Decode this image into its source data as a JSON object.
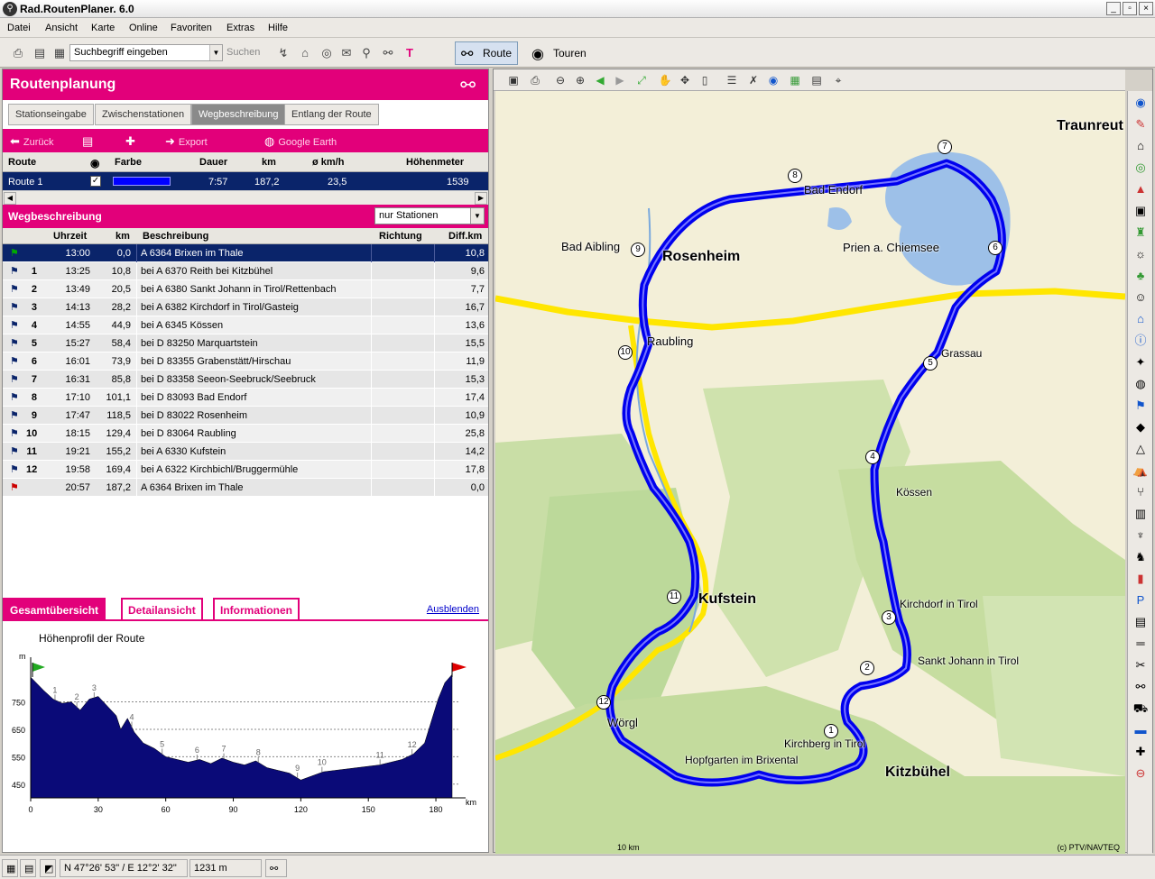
{
  "window": {
    "title": "Rad.RoutenPlaner. 6.0"
  },
  "menu": [
    "Datei",
    "Ansicht",
    "Karte",
    "Online",
    "Favoriten",
    "Extras",
    "Hilfe"
  ],
  "toolbar": {
    "search_value": "Suchbegriff eingeben",
    "search_button": "Suchen",
    "route_button": "Route",
    "tours_button": "Touren"
  },
  "panel": {
    "title": "Routenplanung",
    "tabs": [
      "Stationseingabe",
      "Zwischenstationen",
      "Wegbeschreibung",
      "Entlang der Route"
    ],
    "actions": {
      "back": "Zurück",
      "export": "Export",
      "google_earth": "Google Earth"
    },
    "route_table": {
      "headers": [
        "Route",
        "Farbe",
        "Dauer",
        "km",
        "ø km/h",
        "Höhenmeter"
      ],
      "row": {
        "name": "Route 1",
        "duration": "7:57",
        "km": "187,2",
        "speed": "23,5",
        "elevation": "1539",
        "color": "#0000ff"
      }
    },
    "wegbeschreibung": {
      "title": "Wegbeschreibung",
      "filter": "nur Stationen",
      "headers": [
        "Uhrzeit",
        "km",
        "Beschreibung",
        "Richtung",
        "Diff.km"
      ],
      "rows": [
        {
          "num": "",
          "time": "13:00",
          "km": "0,0",
          "desc": "A 6364 Brixen im Thale",
          "dir": "",
          "diff": "10,8"
        },
        {
          "num": "1",
          "time": "13:25",
          "km": "10,8",
          "desc": "bei A 6370 Reith bei Kitzbühel",
          "dir": "",
          "diff": "9,6"
        },
        {
          "num": "2",
          "time": "13:49",
          "km": "20,5",
          "desc": "bei A 6380 Sankt Johann in Tirol/Rettenbach",
          "dir": "",
          "diff": "7,7"
        },
        {
          "num": "3",
          "time": "14:13",
          "km": "28,2",
          "desc": "bei A 6382 Kirchdorf in Tirol/Gasteig",
          "dir": "",
          "diff": "16,7"
        },
        {
          "num": "4",
          "time": "14:55",
          "km": "44,9",
          "desc": "bei A 6345 Kössen",
          "dir": "",
          "diff": "13,6"
        },
        {
          "num": "5",
          "time": "15:27",
          "km": "58,4",
          "desc": "bei D 83250 Marquartstein",
          "dir": "",
          "diff": "15,5"
        },
        {
          "num": "6",
          "time": "16:01",
          "km": "73,9",
          "desc": "bei D 83355 Grabenstätt/Hirschau",
          "dir": "",
          "diff": "11,9"
        },
        {
          "num": "7",
          "time": "16:31",
          "km": "85,8",
          "desc": "bei D 83358 Seeon-Seebruck/Seebruck",
          "dir": "",
          "diff": "15,3"
        },
        {
          "num": "8",
          "time": "17:10",
          "km": "101,1",
          "desc": "bei D 83093 Bad Endorf",
          "dir": "",
          "diff": "17,4"
        },
        {
          "num": "9",
          "time": "17:47",
          "km": "118,5",
          "desc": "bei D 83022 Rosenheim",
          "dir": "",
          "diff": "10,9"
        },
        {
          "num": "10",
          "time": "18:15",
          "km": "129,4",
          "desc": "bei D 83064 Raubling",
          "dir": "",
          "diff": "25,8"
        },
        {
          "num": "11",
          "time": "19:21",
          "km": "155,2",
          "desc": "bei A 6330 Kufstein",
          "dir": "",
          "diff": "14,2"
        },
        {
          "num": "12",
          "time": "19:58",
          "km": "169,4",
          "desc": "bei A 6322 Kirchbichl/Bruggermühle",
          "dir": "",
          "diff": "17,8"
        },
        {
          "num": "",
          "time": "20:57",
          "km": "187,2",
          "desc": "A 6364 Brixen im Thale",
          "dir": "",
          "diff": "0,0"
        }
      ]
    },
    "bottom_tabs": [
      "Gesamtübersicht",
      "Detailansicht",
      "Informationen"
    ],
    "hide_link": "Ausblenden",
    "profile_title": "Höhenprofil der Route"
  },
  "chart_data": {
    "type": "area",
    "title": "Höhenprofil der Route",
    "xlabel": "km",
    "ylabel": "m",
    "xlim": [
      0,
      190
    ],
    "ylim": [
      400,
      880
    ],
    "x_ticks": [
      0,
      30,
      60,
      90,
      120,
      150,
      180
    ],
    "y_ticks": [
      450,
      550,
      650,
      750
    ],
    "series": [
      {
        "x": [
          0,
          3,
          6,
          10,
          14,
          18,
          22,
          26,
          30,
          34,
          38,
          40,
          43,
          46,
          50,
          55,
          60,
          65,
          70,
          75,
          80,
          85,
          90,
          95,
          100,
          105,
          110,
          115,
          120,
          125,
          130,
          135,
          140,
          145,
          150,
          155,
          160,
          165,
          170,
          175,
          178,
          181,
          184,
          187.2
        ],
        "y": [
          840,
          815,
          790,
          760,
          745,
          750,
          720,
          760,
          770,
          735,
          700,
          650,
          690,
          640,
          600,
          580,
          550,
          540,
          530,
          540,
          525,
          545,
          530,
          520,
          535,
          510,
          500,
          490,
          465,
          480,
          495,
          500,
          505,
          510,
          515,
          520,
          530,
          540,
          560,
          600,
          680,
          760,
          820,
          850
        ]
      }
    ],
    "markers": [
      {
        "label": "1",
        "x": 10.8
      },
      {
        "label": "2",
        "x": 20.5
      },
      {
        "label": "3",
        "x": 28.2
      },
      {
        "label": "4",
        "x": 44.9
      },
      {
        "label": "5",
        "x": 58.4
      },
      {
        "label": "6",
        "x": 73.9
      },
      {
        "label": "7",
        "x": 85.8
      },
      {
        "label": "8",
        "x": 101.1
      },
      {
        "label": "9",
        "x": 118.5
      },
      {
        "label": "10",
        "x": 129.4
      },
      {
        "label": "11",
        "x": 155.2
      },
      {
        "label": "12",
        "x": 169.4
      }
    ],
    "colors": {
      "fill": "#0a0a78",
      "start_flag": "#22aa22",
      "end_flag": "#dd0000"
    }
  },
  "map": {
    "cities": [
      "Rosenheim",
      "Kufstein",
      "Kitzbühel",
      "Traunreut",
      "Prien a. Chiemsee",
      "Bad Endorf",
      "Bad Aibling",
      "Raubling",
      "Kössen",
      "Grassau",
      "Kirchdorf in Tirol",
      "Sankt Johann in Tirol",
      "Wörgl",
      "Kirchberg in Tirol",
      "Hopfgarten im Brixental"
    ],
    "scale": "10 km",
    "copyright": "(c) PTV/NAVTEQ"
  },
  "status": {
    "coords": "N 47°26' 53\" / E 12°2' 32\"",
    "altitude": "1231 m"
  }
}
